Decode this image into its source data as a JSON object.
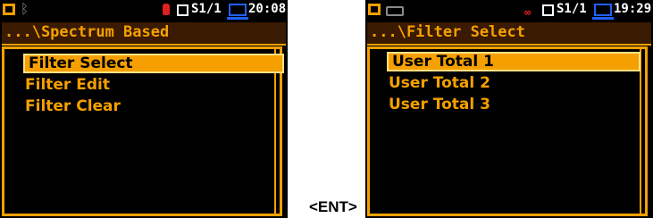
{
  "left_screen": {
    "status": {
      "s_indicator": "S1/1",
      "time": "20:08"
    },
    "title": "...\\Spectrum Based",
    "items": [
      {
        "label": "Filter Select",
        "selected": true
      },
      {
        "label": "Filter Edit",
        "selected": false
      },
      {
        "label": "Filter Clear",
        "selected": false
      }
    ]
  },
  "key_label": "<ENT>",
  "right_screen": {
    "status": {
      "s_indicator": "S1/1",
      "time": "19:29"
    },
    "title": "...\\Filter Select",
    "items": [
      {
        "label": "User Total 1",
        "selected": true
      },
      {
        "label": "User Total 2",
        "selected": false
      },
      {
        "label": "User Total 3",
        "selected": false
      }
    ]
  },
  "colors": {
    "accent": "#f5a000",
    "background": "#000000",
    "status_red": "#e02020",
    "status_blue": "#2060ff"
  },
  "icons": [
    "sd-card-icon",
    "bluetooth-icon",
    "battery-icon",
    "microphone-icon",
    "loop-icon",
    "square-indicator-icon",
    "pc-connection-icon"
  ]
}
